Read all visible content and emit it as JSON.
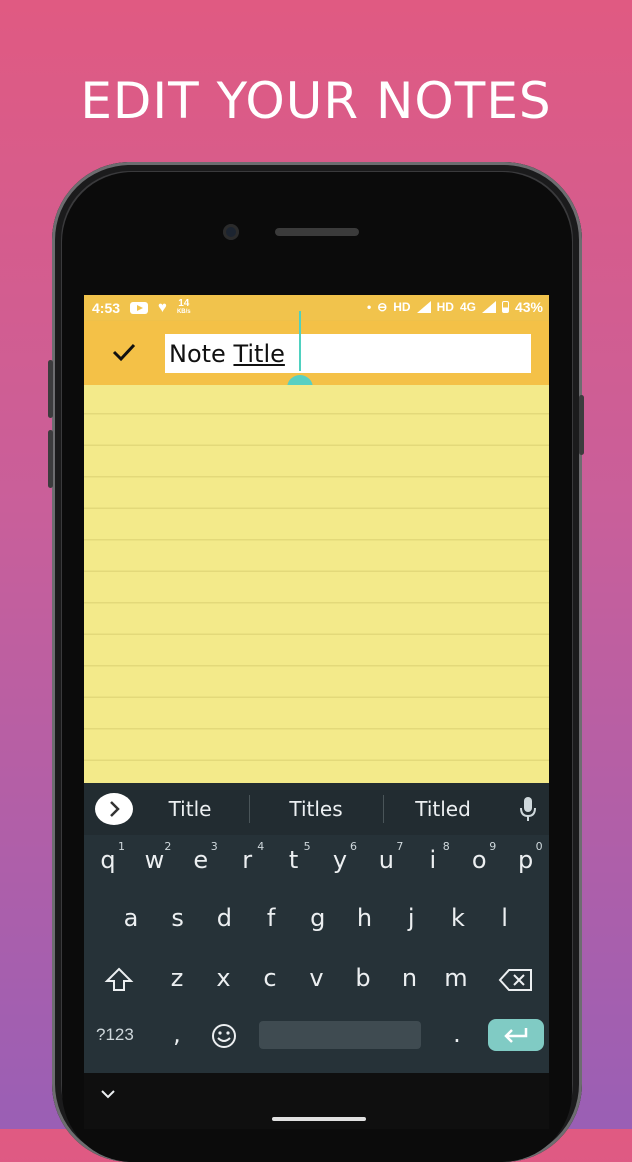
{
  "banner": {
    "headline": "EDIT YOUR NOTES"
  },
  "status_bar": {
    "time": "4:53",
    "speed": "14",
    "speed_unit": "KB/s",
    "hd1": "HD",
    "hd2": "HD",
    "network": "4G",
    "battery": "43%"
  },
  "toolbar": {
    "title_value_word1": "Note",
    "title_value_word2": "Title"
  },
  "note": {
    "body_text": ""
  },
  "keyboard": {
    "suggestions": [
      "Title",
      "Titles",
      "Titled"
    ],
    "row1": [
      {
        "k": "q",
        "n": "1"
      },
      {
        "k": "w",
        "n": "2"
      },
      {
        "k": "e",
        "n": "3"
      },
      {
        "k": "r",
        "n": "4"
      },
      {
        "k": "t",
        "n": "5"
      },
      {
        "k": "y",
        "n": "6"
      },
      {
        "k": "u",
        "n": "7"
      },
      {
        "k": "i",
        "n": "8"
      },
      {
        "k": "o",
        "n": "9"
      },
      {
        "k": "p",
        "n": "0"
      }
    ],
    "row2": [
      "a",
      "s",
      "d",
      "f",
      "g",
      "h",
      "j",
      "k",
      "l"
    ],
    "row3": [
      "z",
      "x",
      "c",
      "v",
      "b",
      "n",
      "m"
    ],
    "symbols_label": "?123",
    "comma": ",",
    "period": "."
  },
  "colors": {
    "toolbar": "#f4c147",
    "paper": "#f3ea8a",
    "keyboard": "#263238",
    "accent": "#58d0c3"
  }
}
